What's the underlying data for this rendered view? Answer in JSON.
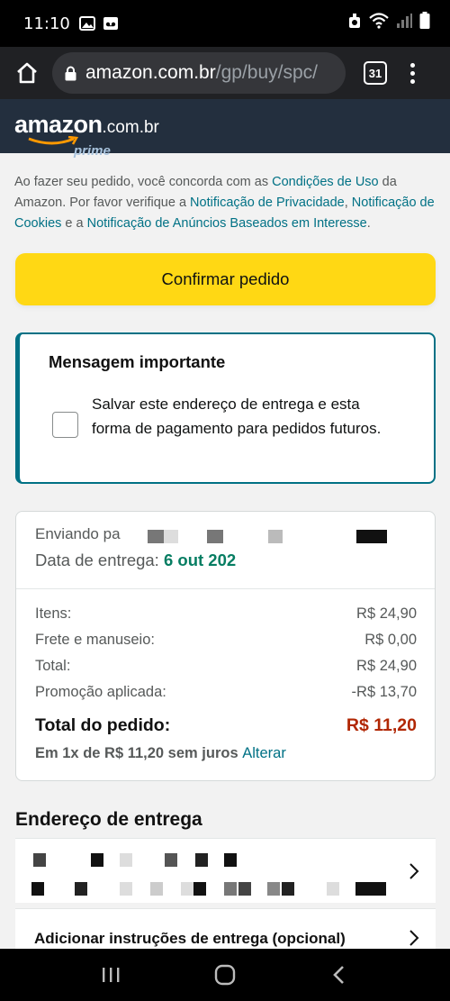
{
  "status_bar": {
    "time": "11:10"
  },
  "browser": {
    "url_domain": "amazon.com.br",
    "url_path": "/gp/buy/spc/",
    "tab_count": "31"
  },
  "header": {
    "logo_word": "amazon",
    "logo_tld": ".com.br",
    "logo_sub": "prime"
  },
  "notice": {
    "t1": "Ao fazer seu pedido, você concorda com as ",
    "link1": "Condições de Uso",
    "t2": " da Amazon. Por favor verifique a ",
    "link2": "Notificação de Privacidade",
    "t3": ", ",
    "link3": "Notificação de Cookies",
    "t4": " e a ",
    "link4": "Notificação de Anúncios Baseados em Interesse",
    "t5": "."
  },
  "confirm_button": "Confirmar pedido",
  "message": {
    "title": "Mensagem importante",
    "checkbox_label": "Salvar este endereço de entrega e esta forma de pagamento para pedidos futuros.",
    "checked": false
  },
  "summary": {
    "ship_to_prefix": "Enviando pa",
    "delivery_label": "Data de entrega: ",
    "delivery_date": "6 out 202",
    "lines": [
      {
        "label": "Itens:",
        "value": "R$ 24,90"
      },
      {
        "label": "Frete e manuseio:",
        "value": "R$ 0,00"
      },
      {
        "label": "Total:",
        "value": "R$ 24,90"
      },
      {
        "label": "Promoção aplicada:",
        "value": "-R$ 13,70"
      }
    ],
    "order_total_label": "Total do pedido:",
    "order_total_value": "R$ 11,20",
    "installment_text": "Em 1x de R$ 11,20 sem juros ",
    "installment_link": "Alterar"
  },
  "address": {
    "section_title": "Endereço de entrega",
    "instructions_label": "Adicionar instruções de entrega (opcional)"
  },
  "colors": {
    "accent_teal": "#007185",
    "button_yellow": "#ffd814",
    "price_red": "#b12704",
    "delivery_green": "#067d62",
    "header_navy": "#232f3e"
  }
}
